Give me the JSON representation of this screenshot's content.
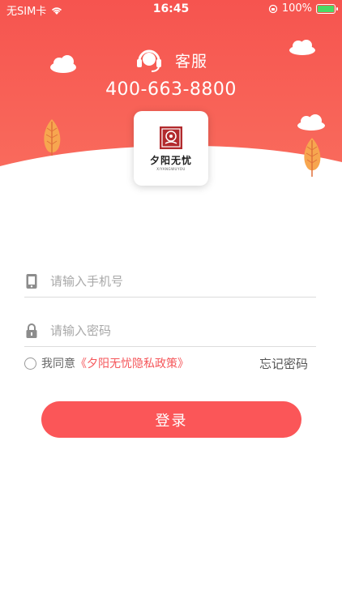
{
  "status_bar": {
    "carrier": "无SIM卡",
    "time": "16:45",
    "battery": "100%"
  },
  "service": {
    "label": "客服",
    "phone": "400-663-8800"
  },
  "logo": {
    "name": "夕阳无忧",
    "subtitle": "XIYANGWUYOU"
  },
  "form": {
    "phone_placeholder": "请输入手机号",
    "password_placeholder": "请输入密码",
    "agree_prefix": "我同意",
    "agree_link": "《夕阳无忧隐私政策》",
    "forgot": "忘记密码",
    "login": "登录"
  },
  "colors": {
    "brand": "#f5565a",
    "button": "#fb5658"
  }
}
